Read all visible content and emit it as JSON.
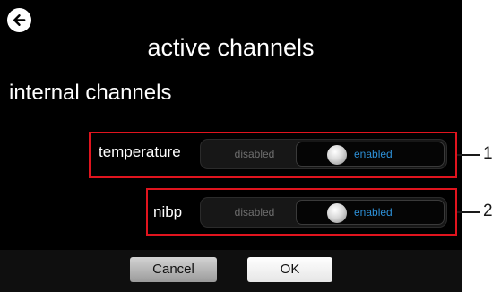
{
  "dialog": {
    "title": "active channels",
    "section_title": "internal channels"
  },
  "channels": [
    {
      "label": "temperature",
      "off_label": "disabled",
      "on_label": "enabled",
      "state": "enabled"
    },
    {
      "label": "nibp",
      "off_label": "disabled",
      "on_label": "enabled",
      "state": "enabled"
    }
  ],
  "callouts": [
    "1",
    "2"
  ],
  "buttons": {
    "cancel": "Cancel",
    "ok": "OK"
  },
  "icons": {
    "back": "back-arrow-icon",
    "toggle_knob": "toggle-knob-icon"
  },
  "colors": {
    "screen_background": "#000000",
    "enabled_text": "#2d8fd6",
    "callout_border": "#e0141e"
  }
}
